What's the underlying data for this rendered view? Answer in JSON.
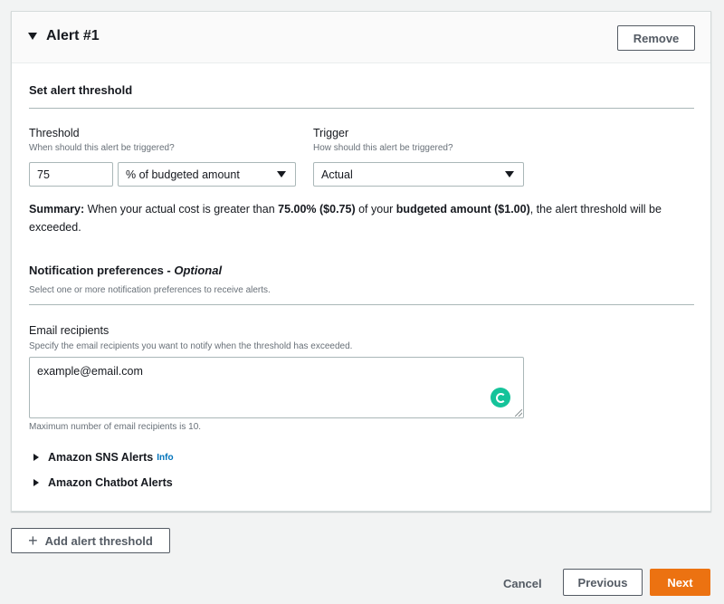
{
  "alert": {
    "title": "Alert #1",
    "remove_label": "Remove"
  },
  "threshold_section": {
    "title": "Set alert threshold",
    "threshold_label": "Threshold",
    "threshold_desc": "When should this alert be triggered?",
    "threshold_value": "75",
    "threshold_type": "% of budgeted amount",
    "trigger_label": "Trigger",
    "trigger_desc": "How should this alert be triggered?",
    "trigger_value": "Actual"
  },
  "summary": {
    "label": "Summary:",
    "text1": " When your actual cost is greater than ",
    "percent": "75.00% ($0.75)",
    "text2": " of your ",
    "budget": "budgeted amount ($1.00)",
    "text3": ", the alert threshold will be exceeded."
  },
  "notification": {
    "title": "Notification preferences - ",
    "optional": "Optional",
    "desc": "Select one or more notification preferences to receive alerts."
  },
  "email": {
    "label": "Email recipients",
    "desc": "Specify the email recipients you want to notify when the threshold has exceeded.",
    "value": "example@email.com",
    "max_note": "Maximum number of email recipients is 10."
  },
  "expanders": {
    "sns_label": "Amazon SNS Alerts",
    "sns_info": "Info",
    "chatbot_label": "Amazon Chatbot Alerts"
  },
  "footer": {
    "add_threshold": "Add alert threshold",
    "cancel": "Cancel",
    "previous": "Previous",
    "next": "Next"
  },
  "colors": {
    "accent": "#ec7211",
    "link": "#0073bb",
    "grammarly": "#15c39a"
  },
  "icons": [
    "caret-down-icon",
    "plus-icon",
    "chevron-right-icon",
    "grammarly-icon",
    "resize-handle-icon"
  ]
}
